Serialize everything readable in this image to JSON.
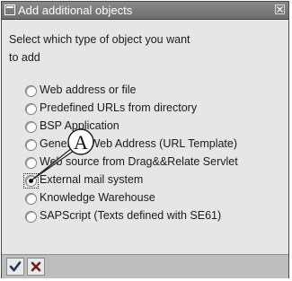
{
  "window": {
    "title": "Add additional objects"
  },
  "prompt": {
    "line1": "Select which type of object you want",
    "line2": "to add"
  },
  "options": [
    {
      "label": "Web address or file",
      "selected": false
    },
    {
      "label": "Predefined URLs from directory",
      "selected": false
    },
    {
      "label": "BSP Application",
      "selected": false
    },
    {
      "label": "Generate Web Address (URL Template)",
      "selected": false
    },
    {
      "label": "Web source from Drag&&Relate Servlet",
      "selected": false
    },
    {
      "label": "External mail system",
      "selected": true
    },
    {
      "label": "Knowledge Warehouse",
      "selected": false
    },
    {
      "label": "SAPScript (Texts defined with SE61)",
      "selected": false
    }
  ],
  "callout": {
    "letter": "A"
  },
  "footer": {
    "buttons": [
      {
        "icon": "checkmark-icon"
      },
      {
        "icon": "cancel-x-icon"
      }
    ]
  }
}
